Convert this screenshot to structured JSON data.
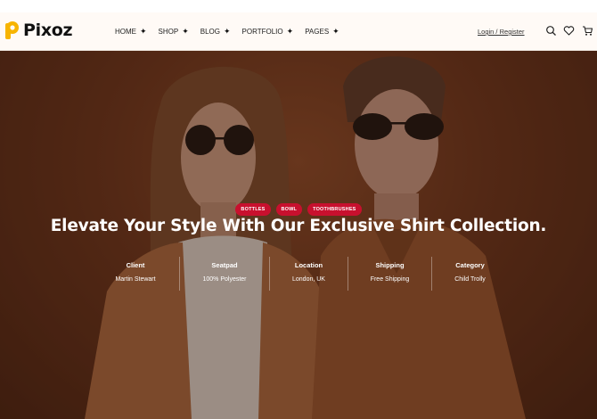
{
  "header": {
    "brand": "Pixoz",
    "brand_colors": {
      "yellow": "#f7b400",
      "dark": "#111111"
    },
    "nav": [
      {
        "label": "HOME"
      },
      {
        "label": "SHOP"
      },
      {
        "label": "BLOG"
      },
      {
        "label": "PORTFOLIO"
      },
      {
        "label": "PAGES"
      }
    ],
    "login_label": "Login / Register",
    "icons": [
      "search-icon",
      "heart-icon",
      "cart-icon"
    ]
  },
  "hero": {
    "tags": [
      "BOTTLES",
      "BOWL",
      "TOOTHBRUSHES"
    ],
    "tag_color": "#c8102e",
    "headline": "Elevate Your Style With Our Exclusive Shirt Collection.",
    "meta": [
      {
        "label": "Client",
        "value": "Martin Stewart"
      },
      {
        "label": "Seatpad",
        "value": "100% Polyester"
      },
      {
        "label": "Location",
        "value": "London, UK"
      },
      {
        "label": "Shipping",
        "value": "Free Shipping"
      },
      {
        "label": "Category",
        "value": "Child Trolly"
      }
    ]
  }
}
